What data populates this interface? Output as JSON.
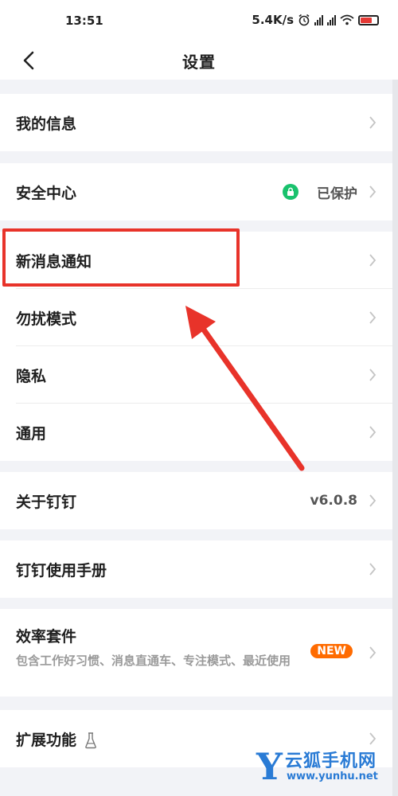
{
  "status_bar": {
    "time": "13:51",
    "net_speed": "5.4K/s"
  },
  "header": {
    "title": "设置"
  },
  "settings": {
    "my_info": "我的信息",
    "security": {
      "label": "安全中心",
      "status": "已保护"
    },
    "notifications": "新消息通知",
    "dnd": "勿扰模式",
    "privacy": "隐私",
    "general": "通用",
    "about": {
      "label": "关于钉钉",
      "version": "v6.0.8"
    },
    "manual": "钉钉使用手册",
    "efficiency": {
      "label": "效率套件",
      "description": "包含工作好习惯、消息直通车、专注模式、最近使用",
      "badge": "NEW"
    },
    "extensions": "扩展功能"
  },
  "watermark": {
    "letter": "Y",
    "name": "云狐手机网",
    "url": "www.yunhu.net"
  },
  "colors": {
    "accent_red": "#e8332a",
    "badge_orange": "#ff6b00",
    "secure_green": "#19c26d",
    "watermark_blue": "#2a7bd5"
  }
}
